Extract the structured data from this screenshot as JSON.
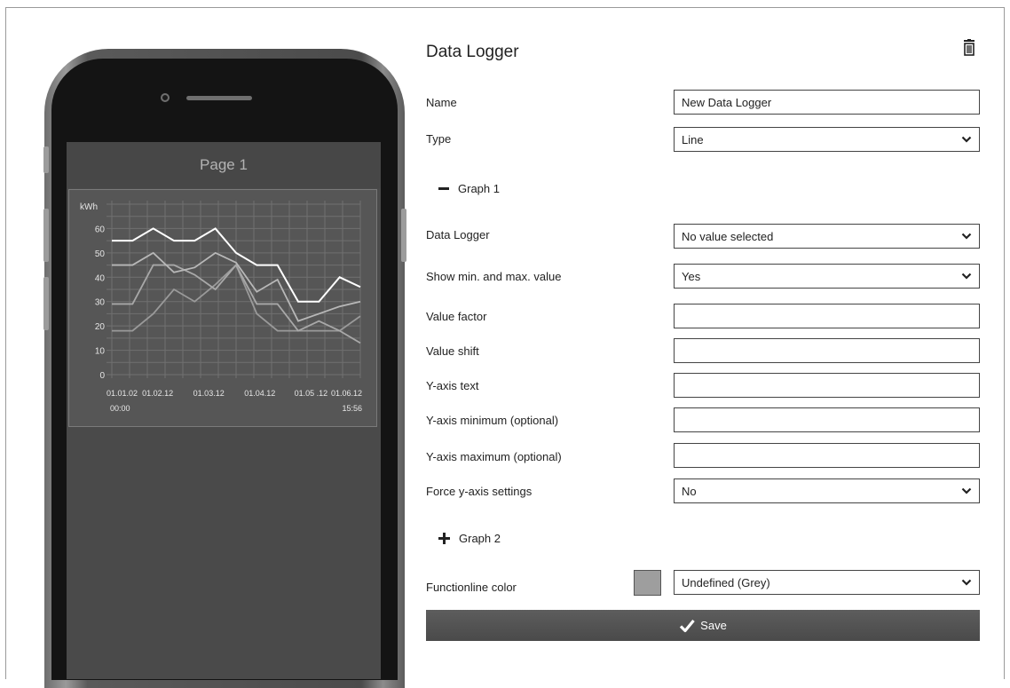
{
  "phone": {
    "page_title": "Page 1",
    "chart_data": {
      "type": "line",
      "ylabel": "kWh",
      "ylim": [
        0,
        70
      ],
      "y_ticks": [
        0,
        10,
        20,
        30,
        40,
        50,
        60
      ],
      "x_tick_labels": [
        "01.01.02",
        "01.02.12",
        "01.03.12",
        "01.04.12",
        "01.05 .12",
        "01.06.12"
      ],
      "x_start_label": "00:00",
      "x_end_label": "15:56",
      "grid": true,
      "x": [
        0,
        1,
        2,
        3,
        4,
        5,
        6,
        7,
        8,
        9,
        10,
        11
      ],
      "series": [
        {
          "values": [
            55,
            55,
            60,
            55,
            55,
            60,
            50,
            45,
            45,
            30,
            30,
            40,
            36
          ],
          "color": "#ffffff"
        },
        {
          "values": [
            45,
            45,
            50,
            42,
            44,
            50,
            46,
            34,
            39,
            22,
            25,
            28,
            30
          ],
          "color": "#b8b8b8"
        },
        {
          "values": [
            29,
            29,
            45,
            45,
            41,
            35,
            45,
            29,
            29,
            18,
            22,
            18,
            13
          ],
          "color": "#a8a8a8"
        },
        {
          "values": [
            18,
            18,
            25,
            35,
            30,
            37,
            45,
            25,
            18,
            18,
            18,
            18,
            24
          ],
          "color": "#9a9a9a"
        }
      ]
    }
  },
  "form": {
    "title": "Data Logger",
    "name_label": "Name",
    "name_value": "New Data Logger",
    "type_label": "Type",
    "type_value": "Line",
    "graph1_label": "Graph 1",
    "data_logger_label": "Data Logger",
    "data_logger_value": "No value selected",
    "show_minmax_label": "Show min. and max. value",
    "show_minmax_value": "Yes",
    "value_factor_label": "Value factor",
    "value_factor_value": "",
    "value_shift_label": "Value shift",
    "value_shift_value": "",
    "yaxis_text_label": "Y-axis text",
    "yaxis_text_value": "",
    "yaxis_min_label": "Y-axis minimum (optional)",
    "yaxis_min_value": "",
    "yaxis_max_label": "Y-axis maximum (optional)",
    "yaxis_max_value": "",
    "force_yaxis_label": "Force y-axis settings",
    "force_yaxis_value": "No",
    "graph2_label": "Graph 2",
    "functionline_color_label": "Functionline color",
    "functionline_color_value": "Undefined (Grey)",
    "functionline_swatch_color": "#9e9e9e",
    "save_label": "Save"
  },
  "icons": {
    "trash": "trash-icon",
    "chevron": "chevron-down-icon",
    "minus": "minus-icon",
    "plus": "plus-icon",
    "check": "check-icon"
  }
}
